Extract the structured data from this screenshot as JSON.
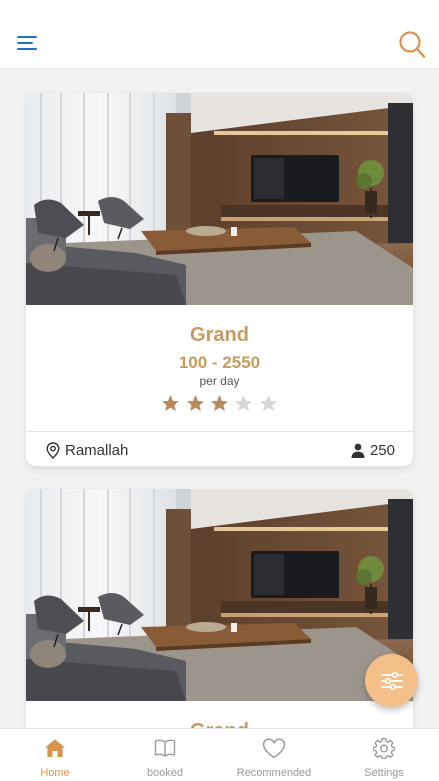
{
  "header": {
    "menu_icon": "menu-icon",
    "search_icon": "search-icon"
  },
  "listings": [
    {
      "name": "Grand",
      "price_range": "100 - 2550",
      "price_unit": "per day",
      "rating": 3,
      "rating_max": 5,
      "location": "Ramallah",
      "capacity": "250"
    },
    {
      "name": "Grand"
    }
  ],
  "filter_button": {
    "icon": "filter-sliders-icon"
  },
  "bottom_nav": {
    "items": [
      {
        "label": "Home",
        "icon": "home-icon",
        "active": true
      },
      {
        "label": "booked",
        "icon": "book-icon",
        "active": false
      },
      {
        "label": "Recommended",
        "icon": "heart-icon",
        "active": false
      },
      {
        "label": "Settings",
        "icon": "gear-icon",
        "active": false
      }
    ]
  },
  "colors": {
    "accent": "#c69a61",
    "fab": "#f3c089",
    "menu_icon": "#1e73c8",
    "star_filled": "#b8895a",
    "star_empty": "#d6d6d6",
    "nav_active": "#d9944f"
  }
}
